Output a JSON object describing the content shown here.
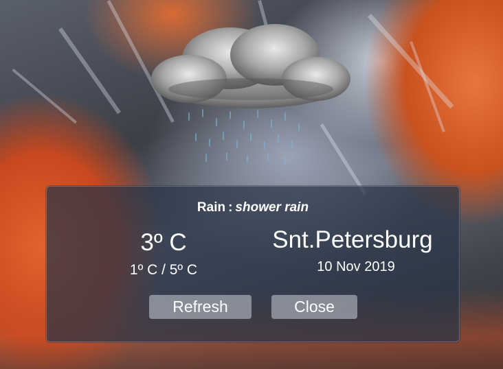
{
  "weather": {
    "condition": "Rain",
    "separator": ":",
    "detail": "shower rain",
    "icon": "rain-cloud-icon"
  },
  "temperature": {
    "current": "3º C",
    "range": "1º C / 5º C"
  },
  "location": {
    "city": "Snt.Petersburg",
    "date": "10 Nov 2019"
  },
  "buttons": {
    "refresh": "Refresh",
    "close": "Close"
  },
  "colors": {
    "panel": "#28344680",
    "button": "#c8cdd7"
  }
}
